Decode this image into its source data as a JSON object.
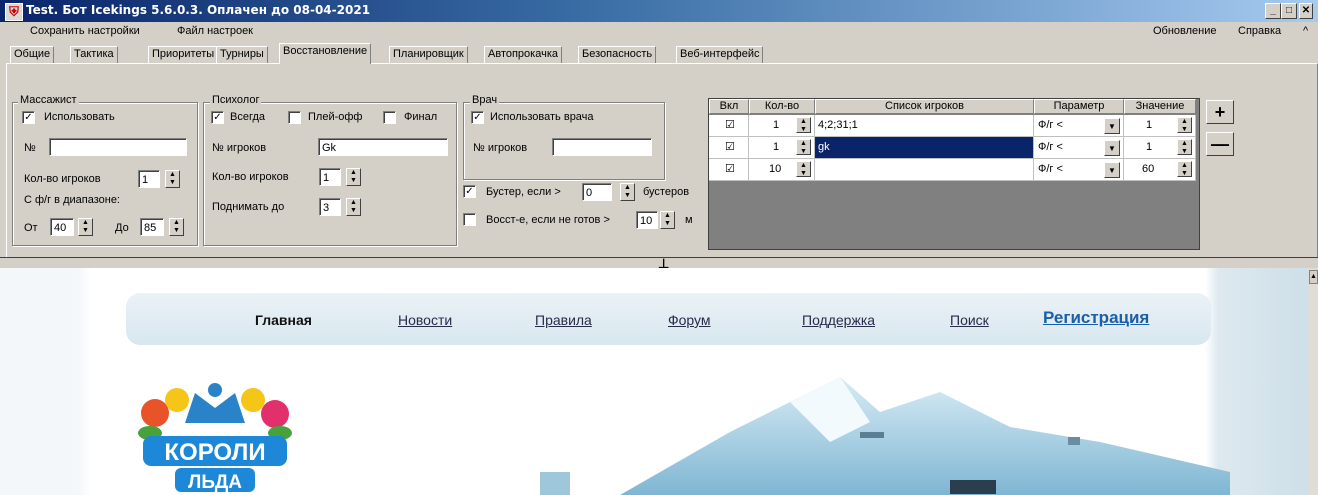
{
  "window": {
    "title": "Test. Бот Icekings 5.6.0.3. Оплачен до 08-04-2021",
    "min": "_",
    "max": "□",
    "close": "✕"
  },
  "menu": {
    "left": [
      "Сохранить настройки",
      "Файл настроек"
    ],
    "right": [
      "Обновление",
      "Справка",
      "^"
    ]
  },
  "tabs": [
    "Общие",
    "Тактика",
    "Приоритеты",
    "Турниры",
    "Восстановление",
    "Планировщик",
    "Автопрокачка",
    "Безопасность",
    "Веб-интерфейс"
  ],
  "active_tab": "Восстановление",
  "masseur": {
    "legend": "Массажист",
    "use_label": "Использовать",
    "use_checked": true,
    "num_label": "№",
    "num_value": "",
    "count_label": "Кол-во игроков",
    "count_value": "1",
    "range_label": "С ф/г в диапазоне:",
    "from_label": "От",
    "from_value": "40",
    "to_label": "До",
    "to_value": "85"
  },
  "psychologist": {
    "legend": "Психолог",
    "always_label": "Всегда",
    "always_checked": true,
    "playoff_label": "Плей-офф",
    "playoff_checked": false,
    "final_label": "Финал",
    "final_checked": false,
    "players_label": "№ игроков",
    "players_value": "Gk",
    "count_label": "Кол-во игроков",
    "count_value": "1",
    "raise_label": "Поднимать до",
    "raise_value": "3"
  },
  "doctor": {
    "legend": "Врач",
    "use_label": "Использовать врача",
    "use_checked": true,
    "players_label": "№ игроков",
    "players_value": "",
    "booster_label": "Бустер, если >",
    "booster_checked": true,
    "booster_value": "0",
    "booster_suffix": "бустеров",
    "recover_label": "Восст-е, если не готов >",
    "recover_checked": false,
    "recover_value": "10",
    "recover_suffix": "м"
  },
  "grid": {
    "headers": [
      "Вкл",
      "Кол-во",
      "Список игроков",
      "Параметр",
      "Значение"
    ],
    "rows": [
      {
        "enabled": "☑",
        "count": "1",
        "players": "4;2;31;1",
        "param": "Ф/г <",
        "value": "1"
      },
      {
        "enabled": "☑",
        "count": "1",
        "players": "gk",
        "param": "Ф/г <",
        "value": "1"
      },
      {
        "enabled": "☑",
        "count": "10",
        "players": "",
        "param": "Ф/г <",
        "value": "60"
      }
    ],
    "add_label": "+",
    "remove_label": "—"
  },
  "splitter_icon": "⊥",
  "site": {
    "nav": [
      "Главная",
      "Новости",
      "Правила",
      "Форум",
      "Поддержка",
      "Поиск",
      "Регистрация"
    ],
    "logo_line1": "КОРОЛИ",
    "logo_line2": "ЛЬДА"
  },
  "colors": {
    "title_gradient_start": "#0a246a",
    "selection": "#0a246a",
    "register_link": "#1a5fa8"
  }
}
